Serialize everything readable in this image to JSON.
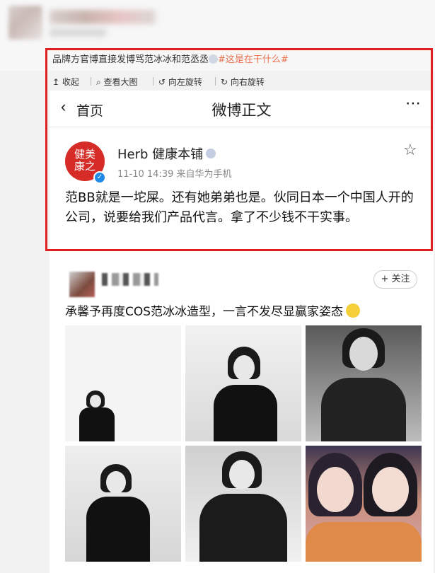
{
  "original_post": {
    "text_prefix": "品牌方官博直接发博骂范冰冰和范丞丞",
    "hashtag": "#这是在干什么#"
  },
  "image_toolbar": {
    "collapse": "↥ 收起",
    "view_large": "⌕ 查看大图",
    "rotate_left": "↺ 向左旋转",
    "rotate_right": "↻ 向右旋转"
  },
  "nav": {
    "back_icon": "‹",
    "back_label": "首页",
    "title": "微博正文",
    "more_icon": "⋯"
  },
  "weibo": {
    "avatar_text_line1": "健美",
    "avatar_text_line2": "康之",
    "author": "Herb 健康本铺",
    "meta": "11-10 14:39  来自华为手机",
    "content": "范BB就是一坨屎。还有她弟弟也是。伙同日本一个中国人开的公司，说要给我们产品代言。拿了不少钱不干实事。"
  },
  "feed": {
    "follow_label": "+ 关注",
    "text": "承馨予再度COS范冰冰造型，一言不发尽显赢家姿态"
  },
  "colors": {
    "highlight_border": "#e02020",
    "hashtag": "#eb7350",
    "verified_blue": "#1f8ae5",
    "brand_red": "#d62c28"
  },
  "icons": [
    "chevron-left-icon",
    "more-icon",
    "star-icon",
    "verified-icon",
    "smile-emoji-icon"
  ]
}
